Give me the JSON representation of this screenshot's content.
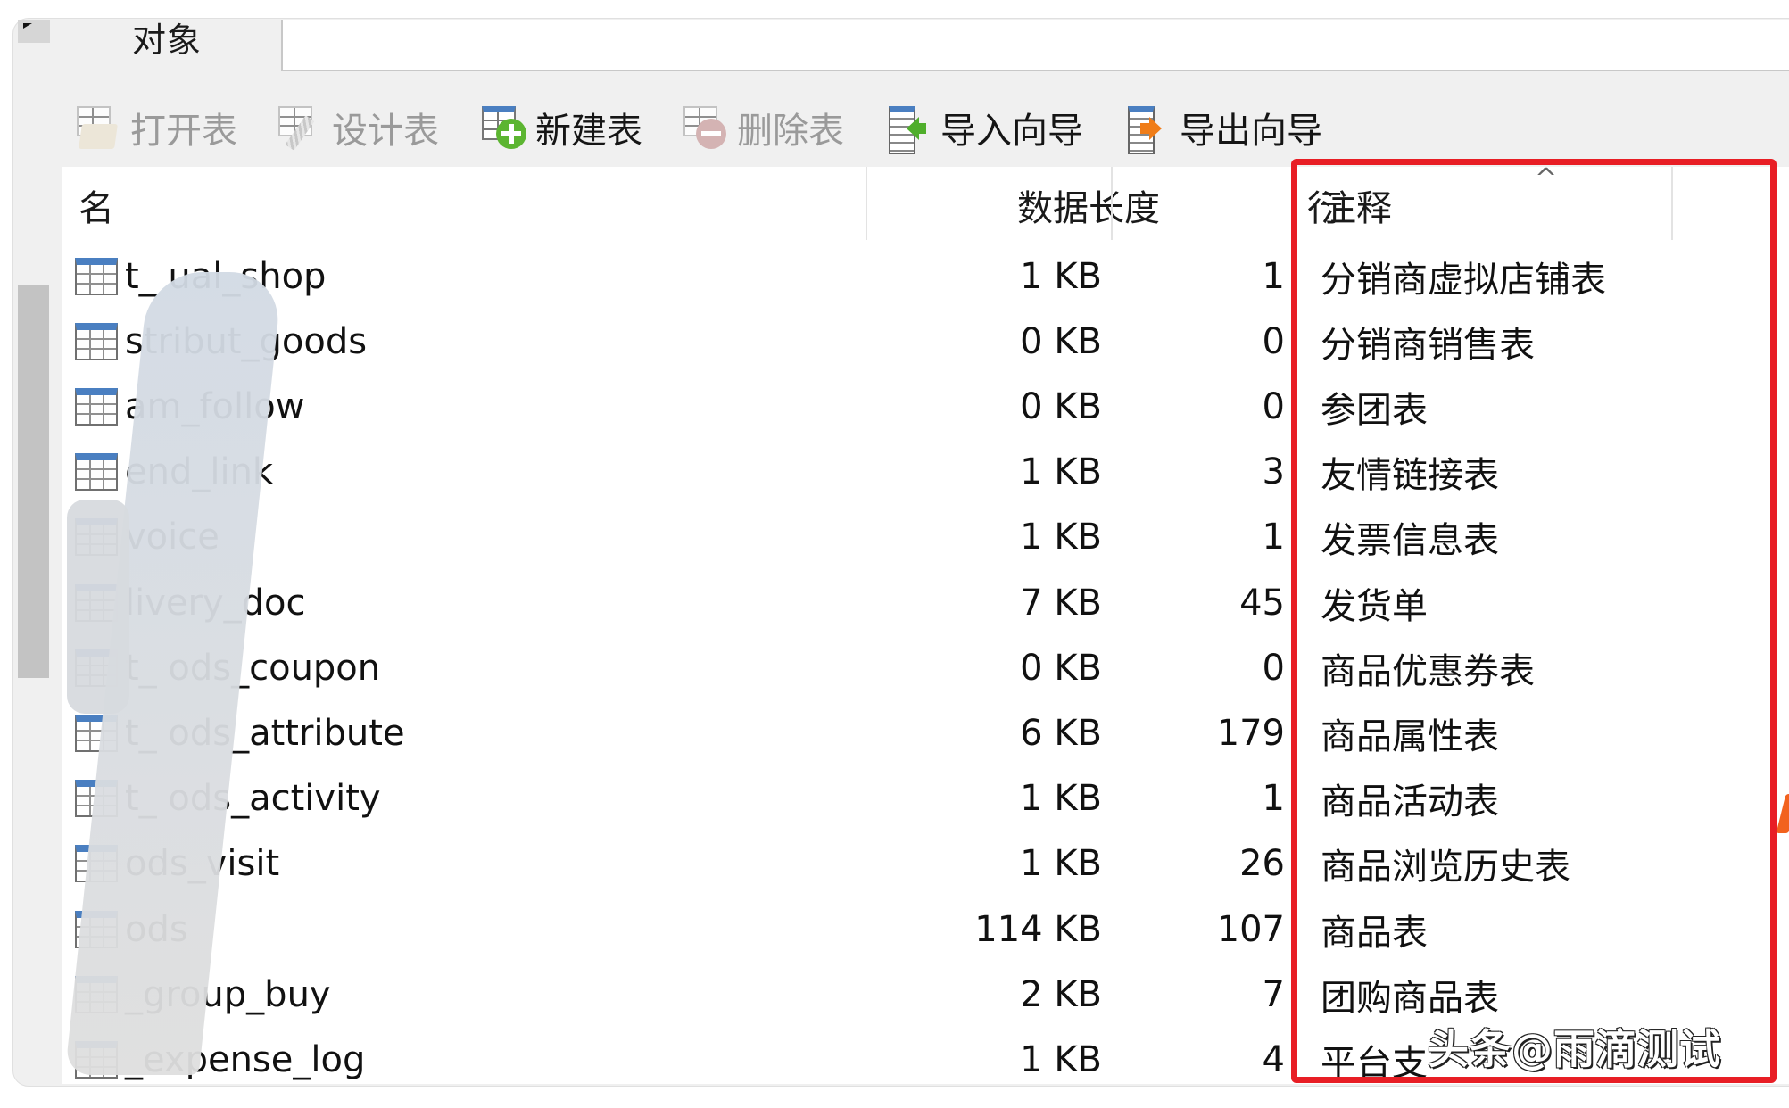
{
  "tab": {
    "label": "对象"
  },
  "toolbar": {
    "open_table": "打开表",
    "design_table": "设计表",
    "new_table": "新建表",
    "delete_table": "删除表",
    "import_wizard": "导入向导",
    "export_wizard": "导出向导"
  },
  "grid": {
    "columns": {
      "name": "名",
      "data_length": "数据长度",
      "rows": "行",
      "comment": "注释"
    },
    "sort_indicator": "^",
    "rows": [
      {
        "name": "t_   ual_shop",
        "data_length": "1 KB",
        "rows": "1",
        "comment": "分销商虚拟店铺表"
      },
      {
        "name": "  stribut_goods",
        "data_length": "0 KB",
        "rows": "0",
        "comment": "分销商销售表"
      },
      {
        "name": "   am_follow",
        "data_length": "0 KB",
        "rows": "0",
        "comment": "参团表"
      },
      {
        "name": "   end_link",
        "data_length": "1 KB",
        "rows": "3",
        "comment": "友情链接表"
      },
      {
        "name": "   voice",
        "data_length": "1 KB",
        "rows": "1",
        "comment": "发票信息表"
      },
      {
        "name": "   livery_doc",
        "data_length": "7 KB",
        "rows": "45",
        "comment": "发货单"
      },
      {
        "name": "t_  ods_coupon",
        "data_length": "0 KB",
        "rows": "0",
        "comment": "商品优惠券表"
      },
      {
        "name": "t_  ods_attribute",
        "data_length": "6 KB",
        "rows": "179",
        "comment": "商品属性表"
      },
      {
        "name": "t_  ods_activity",
        "data_length": "1 KB",
        "rows": "1",
        "comment": "商品活动表"
      },
      {
        "name": "  ods_visit",
        "data_length": "1 KB",
        "rows": "26",
        "comment": "商品浏览历史表"
      },
      {
        "name": "  ods",
        "data_length": "114 KB",
        "rows": "107",
        "comment": "商品表"
      },
      {
        "name": "_group_buy",
        "data_length": "2 KB",
        "rows": "7",
        "comment": "团购商品表"
      },
      {
        "name": "_expense_log",
        "data_length": "1 KB",
        "rows": "4",
        "comment": "平台支"
      }
    ]
  },
  "watermark": "头条@雨滴测试",
  "colors": {
    "highlight_border": "#e81e25",
    "table_icon_header": "#4a7fc1",
    "add_icon": "#5cb531",
    "import_arrow": "#4fae2b",
    "export_arrow": "#f07d18"
  }
}
